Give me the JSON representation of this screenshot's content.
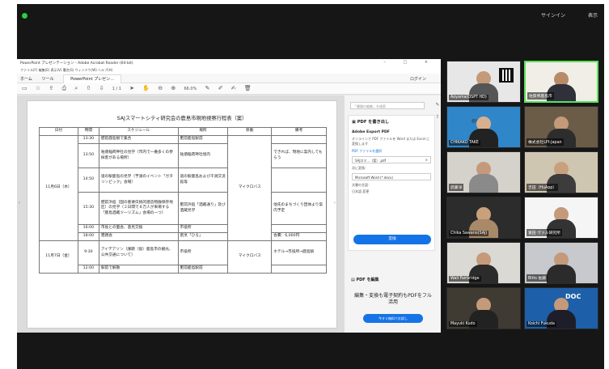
{
  "zoom": {
    "signin": "サインイン",
    "view": "表示"
  },
  "app": {
    "title": "PowerPoint プレゼンテーション - Adobe Acrobat Reader (64-bit)",
    "window_controls": "– □ ×",
    "menu": "ファイル(F)  編集(E)  表示(V)  署名(S)  ウィンドウ(W)  ヘルプ(H)",
    "tabs": {
      "home": "ホーム",
      "tools": "ツール",
      "doc": "PowerPoint プレゼン...",
      "login": "ログイン"
    },
    "page_indicator": "1 / 1",
    "zoom": "66.0%"
  },
  "document": {
    "title": "SAJスマートシティ研究会の鹿島市現地視察行程表（案）",
    "headers": [
      "日付",
      "時間",
      "スケジュール",
      "場所",
      "移動",
      "備考"
    ],
    "day1": "11月6日（木）",
    "day1_move": "マイクロバス",
    "day2": "11月7日（金）",
    "day2_move": "マイクロバス",
    "rows": [
      {
        "time": "13:30",
        "schedule": "肥前鹿島駅で集合",
        "place": "肥前鹿島駅前",
        "note": ""
      },
      {
        "time": "13:50",
        "schedule": "祐徳稲荷神社の見学（市内で一番多くの参拝客がある場所）",
        "place": "祐徳稲荷神社境内",
        "note": "できれば、現地に案内してもらう"
      },
      {
        "time": "14:50",
        "schedule": "道の駅鹿島の見学（予測のイベント「ガタリンピック」会場）",
        "place": "道の駅鹿島および干潟交流館等",
        "note": ""
      },
      {
        "time": "15:30",
        "schedule": "肥前浜宿（国の重要伝統的建造物群保存地区）の見学（２日間で８万人が来場する「鹿島酒蔵ツーリズム」会場の一つ）",
        "place": "肥前浜宿「酒蔵通り」及び酒蔵見学",
        "note": "他先のまちづくり団体より案内予定"
      },
      {
        "time": "16:00",
        "schedule": "市長との面会、意見交換",
        "place": "市役所",
        "note": ""
      },
      {
        "time": "18:00",
        "schedule": "懇親会",
        "place": "割烹「ひろ」",
        "note": "会費：6,000円"
      },
      {
        "time": "9:30",
        "schedule": "アイデアソン（課題（仮）鹿島市の観光、公共交通について）",
        "place": "市役所",
        "note": "ホテル→市役所→鹿島駅"
      },
      {
        "time": "12:00",
        "schedule": "駅前で解散",
        "place": "肥前鹿島駅前",
        "note": ""
      }
    ]
  },
  "panel": {
    "search": "「書類の編集」を検索",
    "export_title": "PDF を書き出し",
    "export_product": "Adobe Export PDF",
    "export_desc": "オンラインで PDF ファイルを Word または Excel に変換します",
    "select_file": "PDF ファイルを選択",
    "file_name": "SAJスマ...（案）.pdf",
    "convert_to": "次に変換：",
    "format": "Microsoft Word (*.docx)",
    "doc_lang": "文書の言語：",
    "lang": "日本語 変更",
    "convert_button": "変換",
    "edit_pdf": "PDF を編集",
    "promo": "編集・変換も電子契約もPDFをフル活用",
    "promo_button": "今すぐ無料でお試し"
  },
  "participants": [
    {
      "name": "Aoyama(OSPT HD)",
      "bg": "#e7e7e7",
      "skin": "#c49a7a",
      "cloth": "#555555"
    },
    {
      "name": "佐賀県鹿島市",
      "bg": "#f0eee6",
      "skin": "#b78a68",
      "cloth": "#30303a"
    },
    {
      "name": "CHIKAKO TAKE",
      "bg": "#2f86c9",
      "skin": "#d8b090",
      "cloth": "#222222"
    },
    {
      "name": "株式会社LPI-Japan",
      "bg": "#6b5c48",
      "skin": "#c49a7a",
      "cloth": "#2d2d2d"
    },
    {
      "name": "武藤洋",
      "bg": "#d5d2cc",
      "skin": "#c49a7a",
      "cloth": "#8a8a8a"
    },
    {
      "name": "吉田（HuApp）",
      "bg": "#cfc6b2",
      "skin": "#c9a07c",
      "cloth": "#3c3c3c"
    },
    {
      "name": "Chika Sawano(SAJ)",
      "bg": "#2c2c2c",
      "skin": "#c9a07c",
      "cloth": "#a88968"
    },
    {
      "name": "富田 ヴァル研究所",
      "bg": "#f5f5f5",
      "skin": "#c49a7a",
      "cloth": "#333333"
    },
    {
      "name": "Wall Fairbridge",
      "bg": "#dad9d4",
      "skin": "#c49a7a",
      "cloth": "#2b2b2b"
    },
    {
      "name": "Bitts 佐藤",
      "bg": "#c7c9cc",
      "skin": "#c49a7a",
      "cloth": "#2b2b2b"
    },
    {
      "name": "Mayuki Kudo",
      "bg": "#3f3a32",
      "skin": "#c49a7a",
      "cloth": "#222222"
    },
    {
      "name": "Koichi Fukuda",
      "bg": "#1d5fa8",
      "skin": "#c49a7a",
      "cloth": "#1e1e2a"
    }
  ],
  "tile_labels": {
    "doc_sign": "DOC",
    "fuji": "鹿島スマ"
  }
}
